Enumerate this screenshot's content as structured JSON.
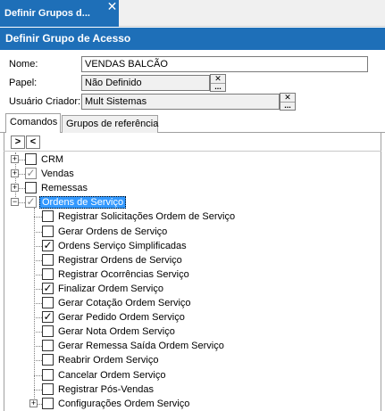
{
  "window_tab": {
    "title": "Definir Grupos d...",
    "close_glyph": "✕"
  },
  "header": {
    "title": "Definir Grupo de Acesso"
  },
  "form": {
    "nome_label": "Nome:",
    "nome_value": "VENDAS BALCÃO",
    "papel_label": "Papel:",
    "papel_value": "Não Definido",
    "usuario_label": "Usuário Criador:",
    "usuario_value": "Mult Sistemas",
    "clear_glyph": "✕",
    "lookup_glyph": "..."
  },
  "tabs": [
    {
      "label": "Comandos",
      "active": true
    },
    {
      "label": "Grupos de referência",
      "active": false
    }
  ],
  "toolbar": {
    "expand_glyph": ">",
    "collapse_glyph": "<"
  },
  "tree": {
    "top_items": [
      {
        "label": "CRM",
        "checked": false,
        "expander": "+"
      },
      {
        "label": "Vendas",
        "checked": true,
        "expander": "+"
      },
      {
        "label": "Remessas",
        "checked": false,
        "expander": "+"
      },
      {
        "label": "Ordens de Serviço",
        "checked": true,
        "expander": "−",
        "selected": true
      }
    ],
    "children": [
      {
        "label": "Registrar Solicitações Ordem de Serviço",
        "checked": false
      },
      {
        "label": "Gerar Ordens de Serviço",
        "checked": false
      },
      {
        "label": "Ordens Serviço Simplificadas",
        "checked": true
      },
      {
        "label": "Registrar Ordens de Serviço",
        "checked": false
      },
      {
        "label": "Registrar Ocorrências Serviço",
        "checked": false
      },
      {
        "label": "Finalizar Ordem Serviço",
        "checked": true
      },
      {
        "label": "Gerar Cotação Ordem Serviço",
        "checked": false
      },
      {
        "label": "Gerar Pedido Ordem Serviço",
        "checked": true
      },
      {
        "label": "Gerar Nota Ordem Serviço",
        "checked": false
      },
      {
        "label": "Gerar Remessa Saída Ordem Serviço",
        "checked": false
      },
      {
        "label": "Reabrir Ordem Serviço",
        "checked": false
      },
      {
        "label": "Cancelar Ordem Serviço",
        "checked": false
      },
      {
        "label": "Registrar Pós-Vendas",
        "checked": false
      },
      {
        "label": "Configurações Ordem Serviço",
        "checked": false,
        "expander": "+"
      }
    ],
    "check_glyph": "✓"
  },
  "colors": {
    "accent": "#1e6fb8",
    "selection": "#3399ff"
  }
}
